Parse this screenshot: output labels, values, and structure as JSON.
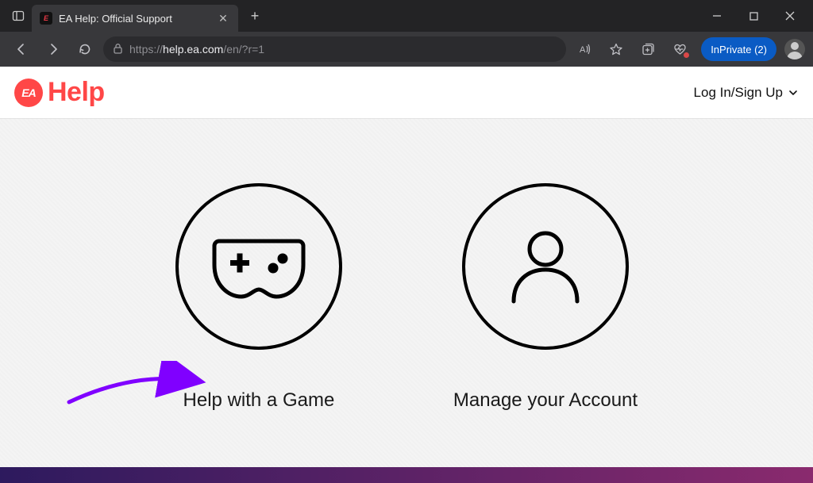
{
  "browser": {
    "tab_title": "EA Help: Official Support",
    "url_host": "help.ea.com",
    "url_prefix": "https://",
    "url_path": "/en/?r=1",
    "inprivate_label": "InPrivate (2)"
  },
  "site_header": {
    "logo_badge": "EA",
    "logo_text": "Help",
    "login_label": "Log In/Sign Up"
  },
  "options": {
    "help_game": "Help with a Game",
    "manage_account": "Manage your Account"
  }
}
